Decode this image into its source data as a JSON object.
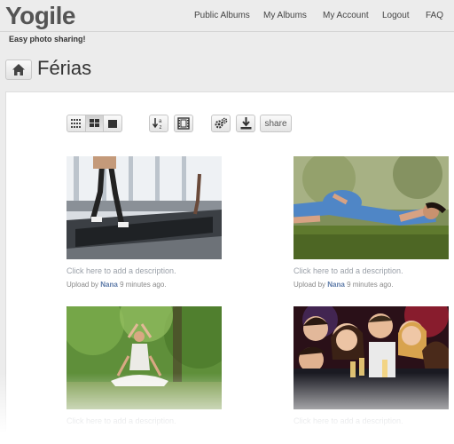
{
  "app": {
    "logo": "Yogile",
    "tagline": "Easy photo sharing!"
  },
  "nav": {
    "public_albums": "Public Albums",
    "my_albums": "My Albums",
    "my_account": "My Account",
    "logout": "Logout",
    "faq": "FAQ"
  },
  "album": {
    "title": "Férias"
  },
  "toolbar": {
    "share_label": "share",
    "active_view": "medium-grid",
    "icons": [
      "small-grid-icon",
      "medium-grid-icon",
      "large-view-icon",
      "sort-az-icon",
      "slideshow-icon",
      "settings-icon",
      "download-icon"
    ]
  },
  "photos": [
    {
      "description": "Click here to add a description.",
      "upload_prefix": "Upload by",
      "user": "Nana",
      "time": "9 minutes ago."
    },
    {
      "description": "Click here to add a description.",
      "upload_prefix": "Upload by",
      "user": "Nana",
      "time": "9 minutes ago."
    },
    {
      "description": "Click here to add a description."
    },
    {
      "description": "Click here to add a description."
    }
  ],
  "colors": {
    "background": "#ececec",
    "panel": "#ffffff",
    "link": "#9aa0a8",
    "username": "#5d7aa8"
  }
}
